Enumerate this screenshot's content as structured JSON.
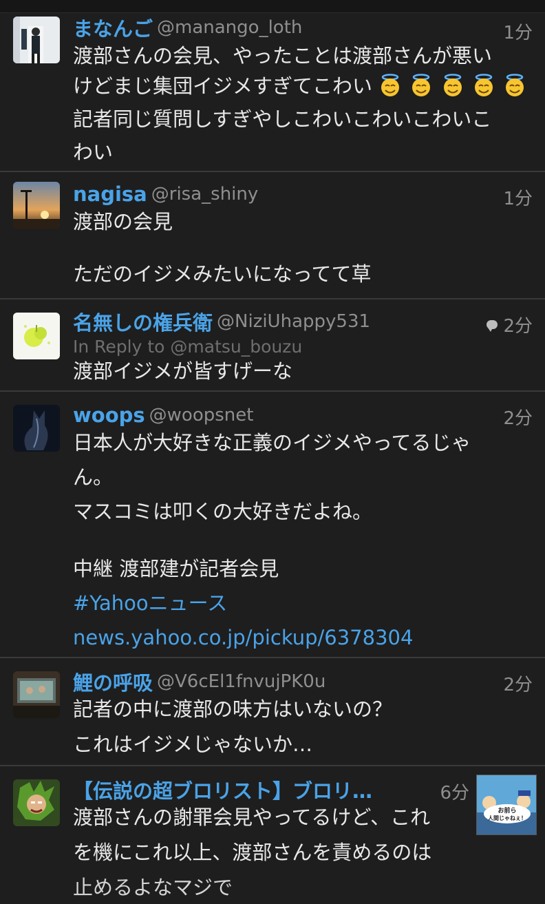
{
  "tweets": [
    {
      "name": "まなんご",
      "handle": "@manango_loth",
      "time": "1分",
      "lines": [
        "渡部さんの会見、やったことは渡部さんが悪い",
        "けどまじ集団イジメすぎてこわい",
        "記者同じ質問しすぎやしこわいこわいこわいこ",
        "わい"
      ],
      "emoji": "smiling-face-with-halo x5"
    },
    {
      "name": "nagisa",
      "handle": "@risa_shiny",
      "time": "1分",
      "lines": [
        "渡部の会見",
        "",
        "ただのイジメみたいになってて草"
      ]
    },
    {
      "name": "名無しの権兵衛",
      "handle": "@NiziUhappy531",
      "time": "2分",
      "in_reply": "In Reply to @matsu_bouzu",
      "lines": [
        "渡部イジメが皆すげーな"
      ]
    },
    {
      "name": "woops",
      "handle": "@woopsnet",
      "time": "2分",
      "lines": [
        "日本人が大好きな正義のイジメやってるじゃ",
        "ん。",
        "マスコミは叩くの大好きだよね。",
        "",
        "中継 渡部建が記者会見"
      ],
      "hashtag": "#Yahooニュース",
      "url": "news.yahoo.co.jp/pickup/6378304"
    },
    {
      "name": "鯉の呼吸",
      "handle": "@V6cEl1fnvujPK0u",
      "time": "2分",
      "lines": [
        "記者の中に渡部の味方はいないの？",
        "これはイジメじゃないか…"
      ]
    },
    {
      "name": "【伝説の超ブロリスト】ブロリ…",
      "time": "6分",
      "lines": [
        "渡部さんの謝罪会見やってるけど、これ",
        "を機にこれ以上、渡部さんを責めるのは",
        "止めるよなマジで"
      ],
      "thumb_text": [
        "お前ら",
        "人間じゃねぇ！"
      ]
    }
  ],
  "colors": {
    "background": "#1e1e1e",
    "name": "#4aa3e8",
    "meta": "#8f8f8f",
    "divider": "#3a3a3a"
  }
}
